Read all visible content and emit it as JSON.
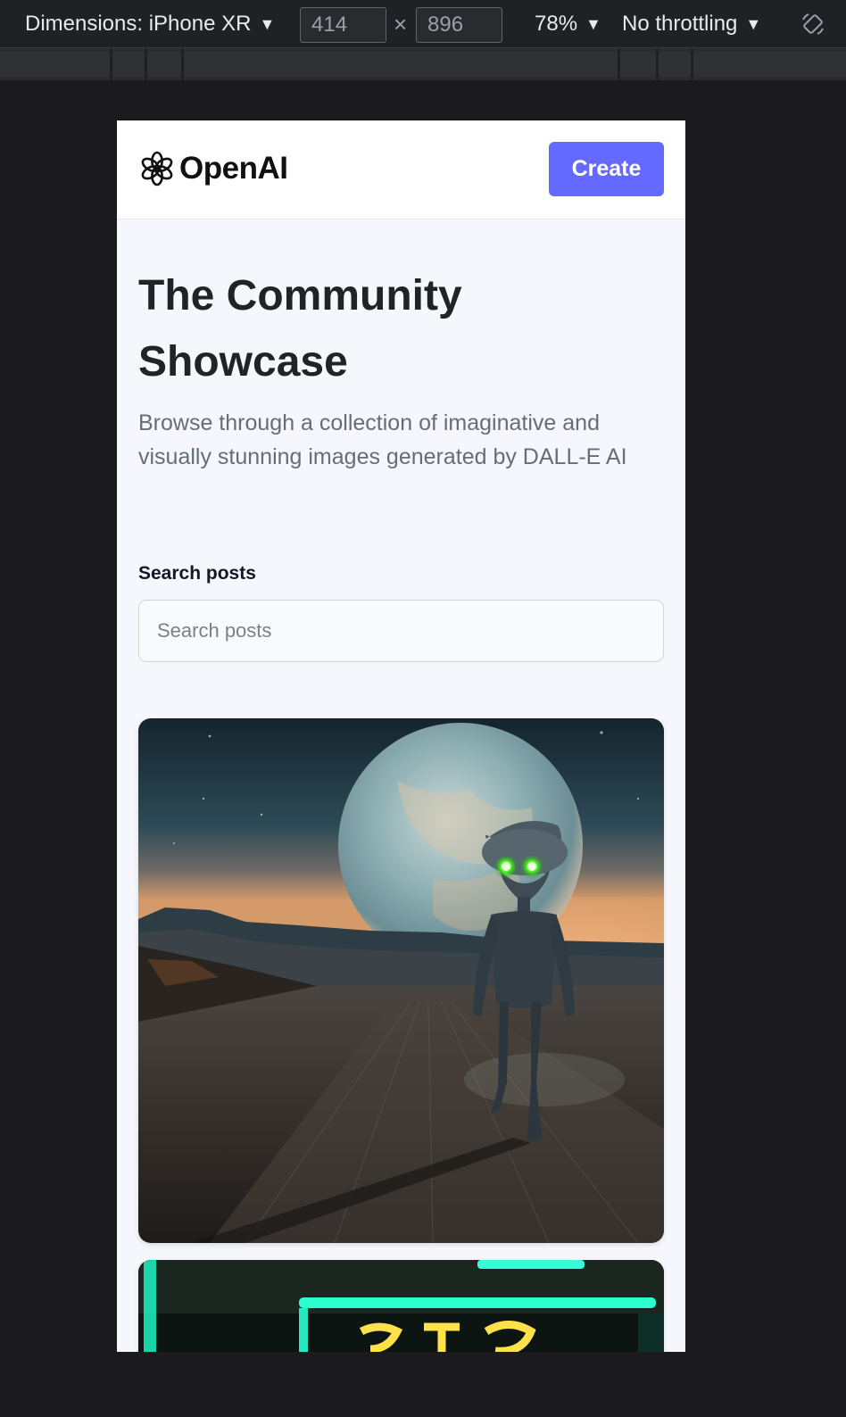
{
  "devtools": {
    "dimensions_label": "Dimensions: iPhone XR",
    "width_value": "414",
    "height_value": "896",
    "times_symbol": "×",
    "zoom_label": "78%",
    "throttle_label": "No throttling",
    "rotate_icon": "rotate-device-icon"
  },
  "site": {
    "brand": "OpenAI",
    "logo_icon": "openai-logo-icon",
    "create_label": "Create",
    "accent_color": "#6469ff"
  },
  "hero": {
    "title": "The Community Showcase",
    "subtitle": "Browse through a collection of imaginative and visually stunning images generated by DALL-E AI"
  },
  "search": {
    "label": "Search posts",
    "placeholder": "Search posts",
    "value": ""
  },
  "gallery": {
    "cards": [
      {
        "image": "alien-walking-on-road-under-planet-image"
      },
      {
        "image": "neon-sign-image"
      }
    ]
  }
}
